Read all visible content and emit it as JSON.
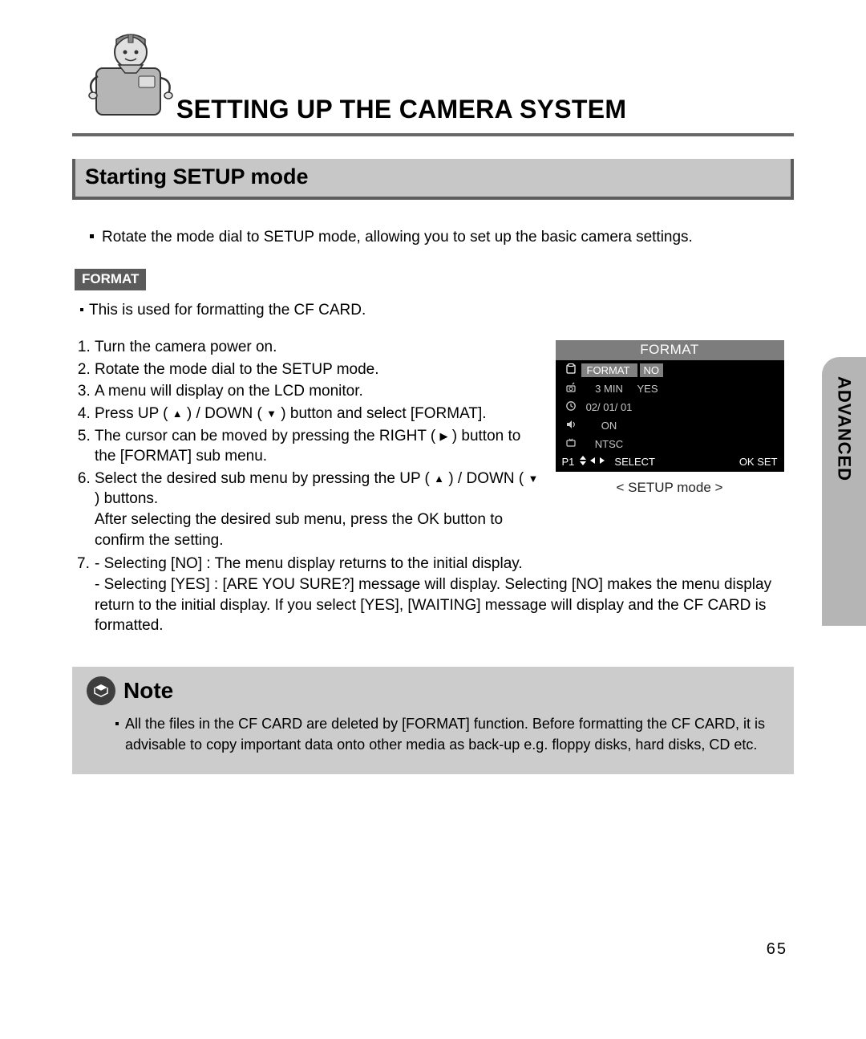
{
  "header": {
    "page_title": "SETTING UP THE CAMERA SYSTEM",
    "section_title": "Starting SETUP mode"
  },
  "intro": "Rotate the mode dial to SETUP mode, allowing you to set up the basic camera settings.",
  "format": {
    "label": "FORMAT",
    "description": "This is used for formatting the CF CARD.",
    "steps": [
      "Turn the camera power on.",
      "Rotate the mode dial to the SETUP mode.",
      "A menu will display on the LCD monitor.",
      "Press UP ( ▲ ) / DOWN ( ▼ ) button and select [FORMAT].",
      "The cursor can be moved by pressing the RIGHT ( ▶ ) button to the [FORMAT] sub menu.",
      "Select the desired sub menu by pressing the UP ( ▲ ) / DOWN ( ▼ ) buttons. After selecting the desired sub menu, press the OK button to confirm the setting."
    ],
    "step7_num": "7.",
    "step7_a": "- Selecting [NO] : The menu display returns to the initial display.",
    "step7_b": "- Selecting [YES] : [ARE YOU SURE?] message will display. Selecting [NO] makes the menu display return to the initial display. If you select [YES], [WAITING] message will display and the CF CARD is formatted."
  },
  "lcd": {
    "title": "FORMAT",
    "rows": [
      {
        "label": "FORMAT",
        "value": "NO",
        "hl": true
      },
      {
        "label": "3 MIN",
        "value": "YES",
        "hl": false
      },
      {
        "label": "02/ 01/ 01",
        "value": "",
        "hl": false
      },
      {
        "label": "ON",
        "value": "",
        "hl": false
      },
      {
        "label": "NTSC",
        "value": "",
        "hl": false
      }
    ],
    "footer": {
      "p": "P1",
      "select": "SELECT",
      "okset": "OK SET"
    },
    "caption": "< SETUP mode >"
  },
  "side_tab": "ADVANCED",
  "note": {
    "title": "Note",
    "body": "All the files in the CF CARD are deleted by [FORMAT] function. Before formatting the CF CARD, it is advisable to copy important data onto other media as back-up e.g. floppy disks, hard disks, CD etc."
  },
  "page_number": "65"
}
